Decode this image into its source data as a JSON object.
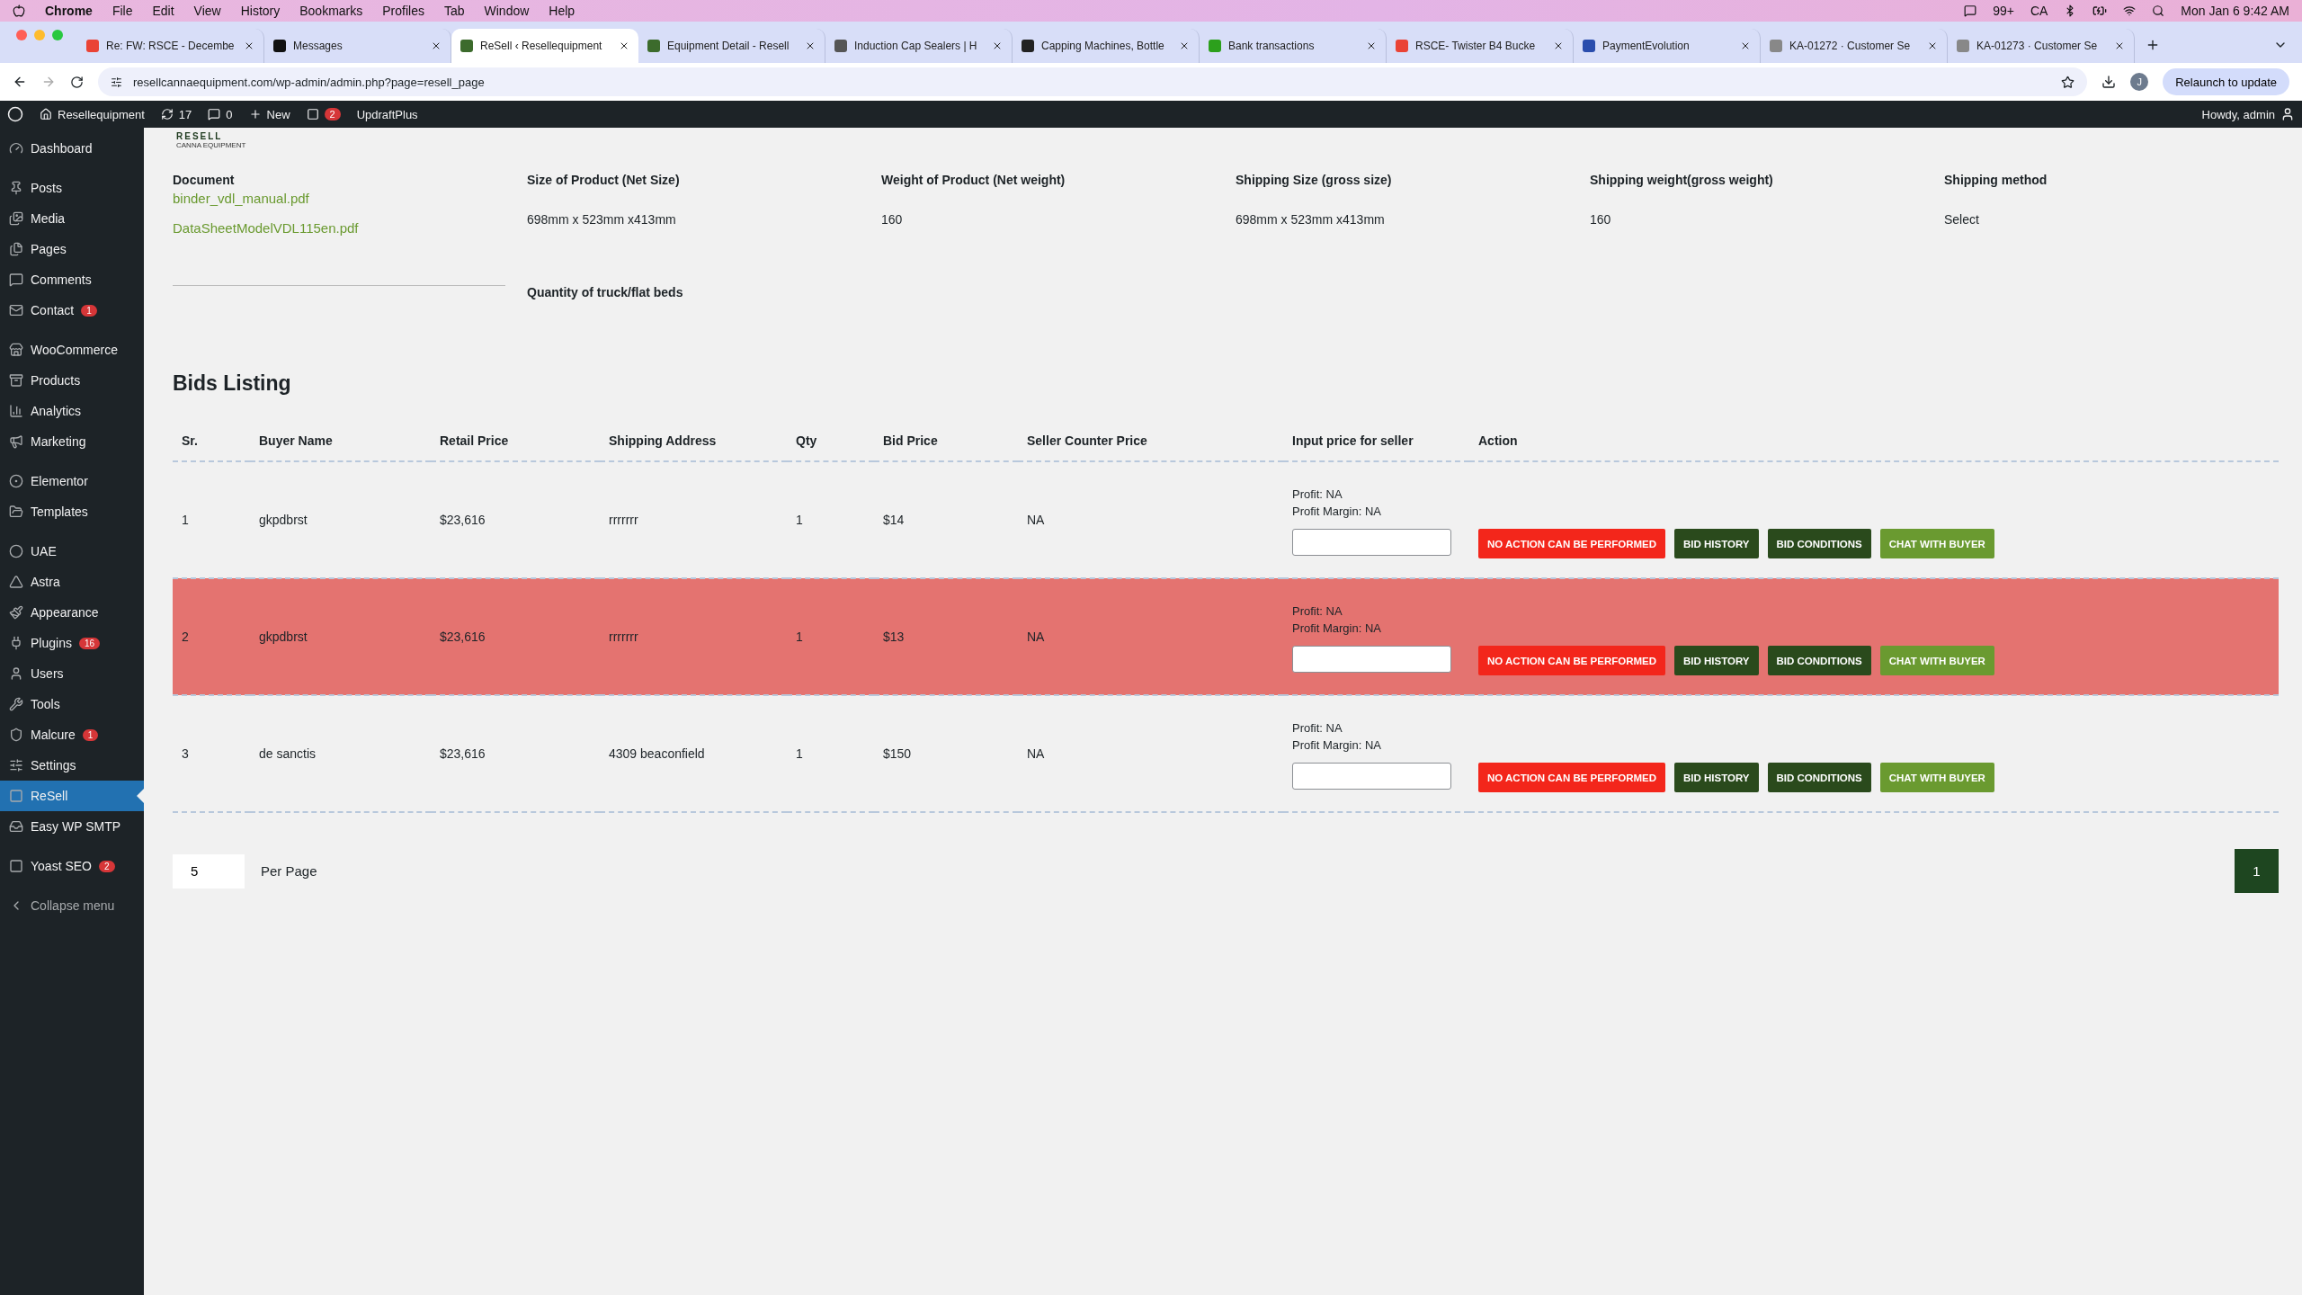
{
  "menu_bar": {
    "app": "Chrome",
    "items": [
      "File",
      "Edit",
      "View",
      "History",
      "Bookmarks",
      "Profiles",
      "Tab",
      "Window",
      "Help"
    ],
    "status": [
      "99+",
      "CA"
    ],
    "clock": "Mon Jan 6  9:42 AM"
  },
  "tabs": [
    {
      "title": "Re: FW: RSCE - Decembe",
      "selected": false
    },
    {
      "title": "Messages",
      "selected": false
    },
    {
      "title": "ReSell ‹ Resellequipment",
      "selected": true
    },
    {
      "title": "Equipment Detail - Resell",
      "selected": false
    },
    {
      "title": "Induction Cap Sealers | H",
      "selected": false
    },
    {
      "title": "Capping Machines, Bottle",
      "selected": false
    },
    {
      "title": "Bank transactions",
      "selected": false
    },
    {
      "title": "RSCE- Twister B4 Bucke",
      "selected": false
    },
    {
      "title": "PaymentEvolution",
      "selected": false
    },
    {
      "title": "KA-01272 · Customer Se",
      "selected": false
    },
    {
      "title": "KA-01273 · Customer Se",
      "selected": false
    }
  ],
  "toolbar": {
    "url": "resellcannaequipment.com/wp-admin/admin.php?page=resell_page",
    "profile": "J",
    "relaunch": "Relaunch to update"
  },
  "admin_bar": {
    "site": "Resellequipment",
    "updates": "17",
    "comments": "0",
    "new": "New",
    "yoast_count": "2",
    "updraft": "UpdraftPlus",
    "howdy": "Howdy, admin"
  },
  "sidebar": {
    "groups": [
      [
        {
          "label": "Dashboard",
          "selected": false
        }
      ],
      [
        {
          "label": "Posts",
          "selected": false
        },
        {
          "label": "Media",
          "selected": false
        },
        {
          "label": "Pages",
          "selected": false
        },
        {
          "label": "Comments",
          "selected": false
        },
        {
          "label": "Contact",
          "badge": "1",
          "selected": false
        }
      ],
      [
        {
          "label": "WooCommerce",
          "selected": false
        },
        {
          "label": "Products",
          "selected": false
        },
        {
          "label": "Analytics",
          "selected": false
        },
        {
          "label": "Marketing",
          "selected": false
        }
      ],
      [
        {
          "label": "Elementor",
          "selected": false
        },
        {
          "label": "Templates",
          "selected": false
        }
      ],
      [
        {
          "label": "UAE",
          "selected": false
        },
        {
          "label": "Astra",
          "selected": false
        },
        {
          "label": "Appearance",
          "selected": false
        },
        {
          "label": "Plugins",
          "badge": "16",
          "selected": false
        },
        {
          "label": "Users",
          "selected": false
        },
        {
          "label": "Tools",
          "selected": false
        },
        {
          "label": "Malcure",
          "badge": "1",
          "selected": false
        },
        {
          "label": "Settings",
          "selected": false
        },
        {
          "label": "ReSell",
          "selected": true
        },
        {
          "label": "Easy WP SMTP",
          "selected": false
        }
      ],
      [
        {
          "label": "Yoast SEO",
          "badge": "2",
          "selected": false
        }
      ]
    ],
    "collapse": "Collapse menu"
  },
  "logo": {
    "name": "RESELL",
    "tagline": "CANNA EQUIPMENT"
  },
  "product_details": {
    "document": {
      "label": "Document",
      "files": [
        "binder_vdl_manual.pdf",
        "DataSheetModelVDL115en.pdf"
      ]
    },
    "fields": [
      {
        "label": "Size of Product (Net Size)",
        "value": "698mm x 523mm x413mm"
      },
      {
        "label": "Weight of Product (Net weight)",
        "value": "160"
      },
      {
        "label": "Shipping Size (gross size)",
        "value": "698mm x 523mm x413mm"
      },
      {
        "label": "Shipping weight(gross weight)",
        "value": "160"
      },
      {
        "label": "Shipping method",
        "value": "Select"
      }
    ],
    "quantity_label": "Quantity of truck/flat beds"
  },
  "bids": {
    "title": "Bids Listing",
    "columns": [
      "Sr.",
      "Buyer Name",
      "Retail Price",
      "Shipping Address",
      "Qty",
      "Bid Price",
      "Seller Counter Price",
      "Input price for seller",
      "Action"
    ],
    "rows": [
      {
        "sr": "1",
        "buyer": "gkpdbrst",
        "retail": "$23,616",
        "address": "rrrrrrr",
        "qty": "1",
        "bid": "$14",
        "counter": "NA",
        "profit": "Profit: NA",
        "margin": "Profit Margin: NA",
        "highlighted": false,
        "actions": [
          {
            "label": "NO ACTION CAN BE PERFORMED",
            "kind": "danger"
          },
          {
            "label": "BID HISTORY",
            "kind": "dark"
          },
          {
            "label": "BID CONDITIONS",
            "kind": "dark"
          },
          {
            "label": "CHAT WITH BUYER",
            "kind": "green"
          }
        ]
      },
      {
        "sr": "2",
        "buyer": "gkpdbrst",
        "retail": "$23,616",
        "address": "rrrrrrr",
        "qty": "1",
        "bid": "$13",
        "counter": "NA",
        "profit": "Profit: NA",
        "margin": "Profit Margin: NA",
        "highlighted": true,
        "actions": [
          {
            "label": "NO ACTION CAN BE PERFORMED",
            "kind": "danger"
          },
          {
            "label": "BID HISTORY",
            "kind": "dark"
          },
          {
            "label": "BID CONDITIONS",
            "kind": "dark"
          },
          {
            "label": "CHAT WITH BUYER",
            "kind": "green"
          }
        ]
      },
      {
        "sr": "3",
        "buyer": "de sanctis",
        "retail": "$23,616",
        "address": "4309 beaconfield",
        "qty": "1",
        "bid": "$150",
        "counter": "NA",
        "profit": "Profit: NA",
        "margin": "Profit Margin: NA",
        "highlighted": false,
        "actions": [
          {
            "label": "NO ACTION CAN BE PERFORMED",
            "kind": "danger"
          },
          {
            "label": "BID HISTORY",
            "kind": "dark"
          },
          {
            "label": "BID CONDITIONS",
            "kind": "dark"
          },
          {
            "label": "CHAT WITH BUYER",
            "kind": "green"
          }
        ]
      }
    ]
  },
  "pagination": {
    "per_page_value": "5",
    "per_page_label": "Per Page",
    "pages": [
      {
        "label": "1",
        "selected": true
      }
    ]
  }
}
